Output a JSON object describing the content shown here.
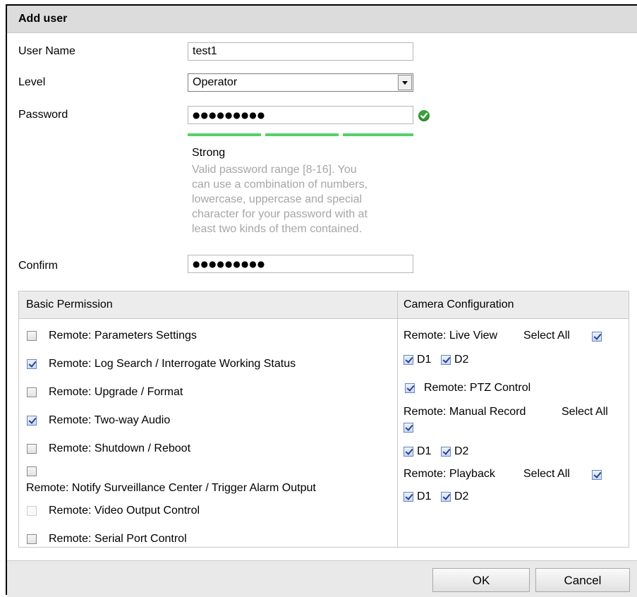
{
  "dialog": {
    "title": "Add user"
  },
  "form": {
    "username_label": "User Name",
    "username_value": "test1",
    "level_label": "Level",
    "level_value": "Operator",
    "password_label": "Password",
    "password_mask": "●●●●●●●●●",
    "password_valid_icon": "check-circle-icon",
    "strength_label": "Strong",
    "strength_bars_filled": 3,
    "strength_color": "#55d06a",
    "hint_lines": [
      "Valid password range [8-16]. You",
      "can use a combination of numbers,",
      "lowercase, uppercase and special",
      "character for your password with at",
      "least two kinds of them contained."
    ],
    "confirm_label": "Confirm",
    "confirm_mask": "●●●●●●●●●"
  },
  "basic_permission": {
    "header": "Basic Permission",
    "items": [
      {
        "label": "Remote: Parameters Settings",
        "checked": false
      },
      {
        "label": "Remote: Log Search / Interrogate Working Status",
        "checked": true
      },
      {
        "label": "Remote: Upgrade / Format",
        "checked": false
      },
      {
        "label": "Remote: Two-way Audio",
        "checked": true
      },
      {
        "label": "Remote: Shutdown / Reboot",
        "checked": false
      },
      {
        "label": "Remote: Notify Surveillance Center / Trigger Alarm Output",
        "checked": false
      },
      {
        "label": "Remote: Video Output Control",
        "checked": false
      },
      {
        "label": "Remote: Serial Port Control",
        "checked": false
      }
    ]
  },
  "camera_config": {
    "header": "Camera Configuration",
    "live_view": {
      "label": "Remote: Live View",
      "select_all": "Select All",
      "select_all_checked": true,
      "d1": "D1",
      "d2": "D2"
    },
    "ptz": {
      "label": "Remote: PTZ Control",
      "checked": true
    },
    "manual_record": {
      "label": "Remote: Manual Record",
      "select_all": "Select All",
      "select_all_checked": true,
      "d1": "D1",
      "d2": "D2"
    },
    "playback": {
      "label": "Remote: Playback",
      "select_all": "Select All",
      "select_all_checked": true,
      "d1": "D1",
      "d2": "D2"
    }
  },
  "footer": {
    "ok": "OK",
    "cancel": "Cancel"
  }
}
